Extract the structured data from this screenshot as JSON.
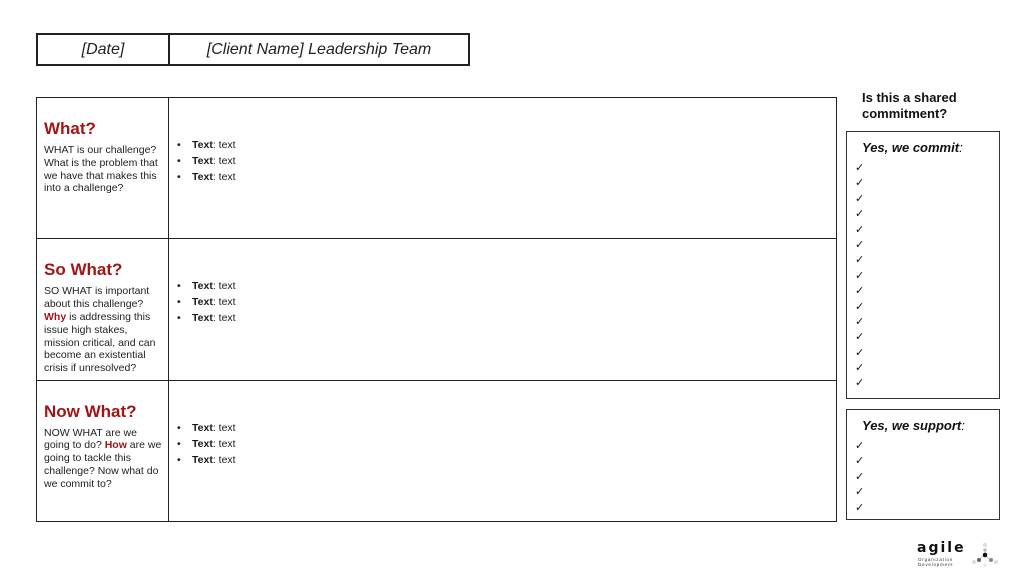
{
  "header": {
    "date": "[Date]",
    "client": "[Client Name] Leadership Team"
  },
  "rows": [
    {
      "title": "What?",
      "desc_parts": [
        "WHAT is our challenge? What is the problem that we have that makes this into a challenge?"
      ],
      "bullets": [
        {
          "label": "Text",
          "value": ": text"
        },
        {
          "label": "Text",
          "value": ": text"
        },
        {
          "label": "Text",
          "value": ": text"
        }
      ]
    },
    {
      "title": "So What?",
      "desc_before": "SO WHAT is important about this challenge? ",
      "desc_highlight": "Why",
      "desc_after": " is addressing this issue high stakes, mission critical, and can become an existential crisis if unresolved?",
      "bullets": [
        {
          "label": "Text",
          "value": ": text"
        },
        {
          "label": "Text",
          "value": ": text"
        },
        {
          "label": "Text",
          "value": ": text"
        }
      ]
    },
    {
      "title": "Now What?",
      "desc_before": "NOW WHAT are we going to do? ",
      "desc_highlight": "How",
      "desc_after": " are we going to tackle this challenge? Now what do we commit to?",
      "bullets": [
        {
          "label": "Text",
          "value": ": text"
        },
        {
          "label": "Text",
          "value": ": text"
        },
        {
          "label": "Text",
          "value": ": text"
        }
      ]
    }
  ],
  "shared": {
    "question": "Is this a shared commitment?",
    "commit_title": "Yes, we commit",
    "commit_checks": 15,
    "support_title": "Yes, we support",
    "support_checks": 5,
    "colon": ":",
    "check_glyph": "✓",
    "bullet_glyph": "•"
  },
  "logo": {
    "word": "agile",
    "sub1": "Organization",
    "sub2": "Development"
  },
  "colors": {
    "accent_red": "#a31515",
    "border": "#222222"
  }
}
